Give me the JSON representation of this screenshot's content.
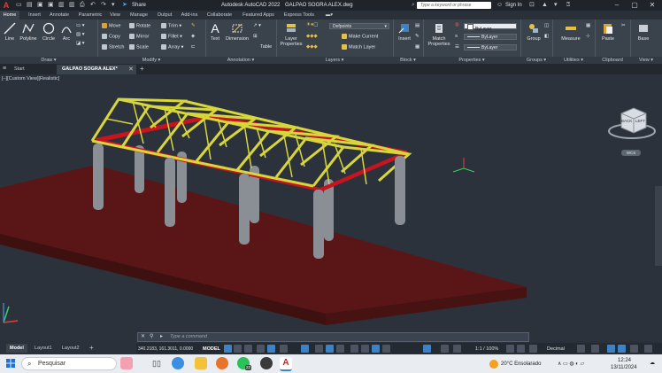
{
  "window": {
    "app_title": "Autodesk AutoCAD 2022",
    "file_title": "GALPAO SOGRA ALEX.dwg",
    "share_label": "Share",
    "search_placeholder": "Type a keyword or phrase",
    "sign_in_label": "Sign In",
    "logo_letter": "A"
  },
  "ribbon_tabs": [
    {
      "label": "Home",
      "active": true
    },
    {
      "label": "Insert"
    },
    {
      "label": "Annotate"
    },
    {
      "label": "Parametric"
    },
    {
      "label": "View"
    },
    {
      "label": "Manage"
    },
    {
      "label": "Output"
    },
    {
      "label": "Add-ins"
    },
    {
      "label": "Collaborate"
    },
    {
      "label": "Featured Apps"
    },
    {
      "label": "Express Tools"
    }
  ],
  "ribbon": {
    "draw": {
      "title": "Draw",
      "line": "Line",
      "polyline": "Polyline",
      "circle": "Circle",
      "arc": "Arc"
    },
    "modify": {
      "title": "Modify",
      "move": "Move",
      "rotate": "Rotate",
      "trim": "Trim",
      "copy": "Copy",
      "mirror": "Mirror",
      "fillet": "Fillet",
      "stretch": "Stretch",
      "scale": "Scale",
      "array": "Array"
    },
    "annotation": {
      "title": "Annotation",
      "text": "Text",
      "dimension": "Dimension",
      "table": "Table"
    },
    "layers": {
      "title": "Layers",
      "layer_properties": "Layer Properties",
      "current_layer": "Defpoints",
      "make_current": "Make Current",
      "match_layer": "Match Layer"
    },
    "block": {
      "title": "Block",
      "insert": "Insert"
    },
    "properties": {
      "title": "Properties",
      "match_properties": "Match Properties",
      "bylayer_1": "ByLayer",
      "bylayer_2": "ByLayer",
      "bylayer_3": "ByLayer"
    },
    "groups": {
      "title": "Groups",
      "group": "Group"
    },
    "utilities": {
      "title": "Utilities",
      "measure": "Measure"
    },
    "clipboard": {
      "title": "Clipboard",
      "paste": "Paste"
    },
    "view": {
      "title": "View",
      "base": "Base"
    }
  },
  "file_tabs": {
    "start": "Start",
    "drawing": "GALPAO SOGRA ALEX*"
  },
  "viewport": {
    "label": "[–][Custom View][Realistic]",
    "viewcube_back": "BACK",
    "viewcube_left": "LEFT",
    "wcs": "WCS"
  },
  "layout_tabs": [
    "Model",
    "Layout1",
    "Layout2"
  ],
  "command": {
    "placeholder": "Type a command"
  },
  "status": {
    "coords": "340.2183, 161.3011, 0.0000",
    "model": "MODEL",
    "scale": "1:1 / 100%",
    "units": "Decimal"
  },
  "taskbar": {
    "search": "Pesquisar",
    "weather": "20°C  Ensolarado",
    "time": "12:24",
    "date": "13/11/2024",
    "whatsapp_badge": "22"
  },
  "colors": {
    "truss": "#d7d63a",
    "beam": "#c8141e",
    "slab": "#5a1616",
    "column": "#8a8f96"
  }
}
